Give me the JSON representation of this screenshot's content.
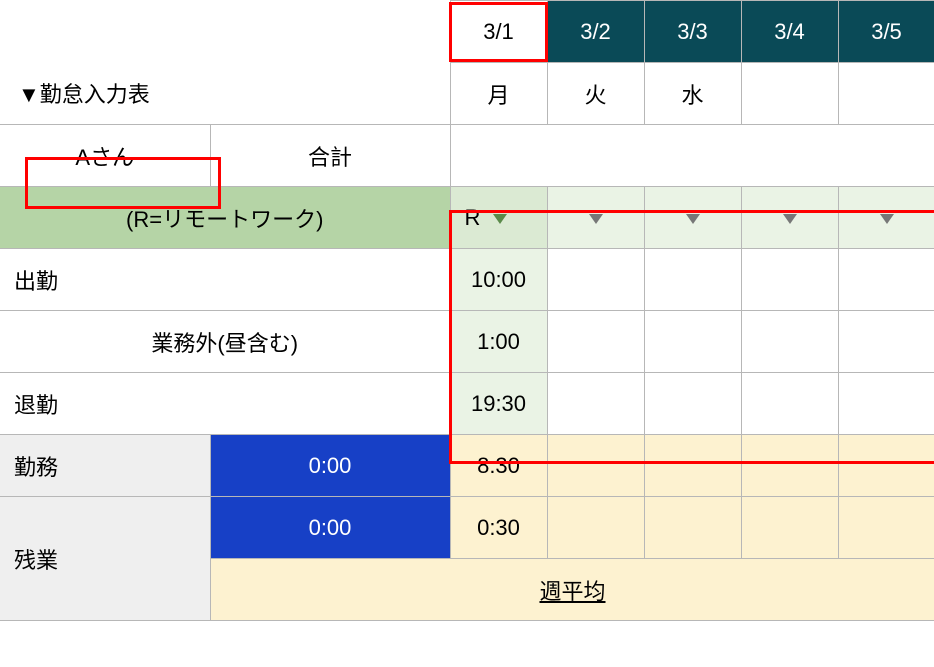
{
  "title": "▼勤怠入力表",
  "person": "Aさん",
  "total_label": "合計",
  "dates": [
    "3/1",
    "3/2",
    "3/3",
    "3/4",
    "3/5"
  ],
  "weekdays": [
    "月",
    "火",
    "水",
    "",
    ""
  ],
  "remote_legend": "(R=リモートワーク)",
  "remote_flag": "R",
  "rows": {
    "start": {
      "label": "出勤",
      "v": [
        "10:00",
        "",
        "",
        "",
        ""
      ]
    },
    "break": {
      "label": "業務外(昼含む)",
      "v": [
        "1:00",
        "",
        "",
        "",
        ""
      ]
    },
    "end": {
      "label": "退勤",
      "v": [
        "19:30",
        "",
        "",
        "",
        ""
      ]
    },
    "work": {
      "label": "勤務",
      "total": "0:00",
      "v": [
        "8:30",
        "",
        "",
        "",
        ""
      ]
    },
    "ot": {
      "label": "残業",
      "total": "0:00",
      "v": [
        "0:30",
        "",
        "",
        "",
        ""
      ]
    },
    "ot_avg_label": "週平均"
  }
}
